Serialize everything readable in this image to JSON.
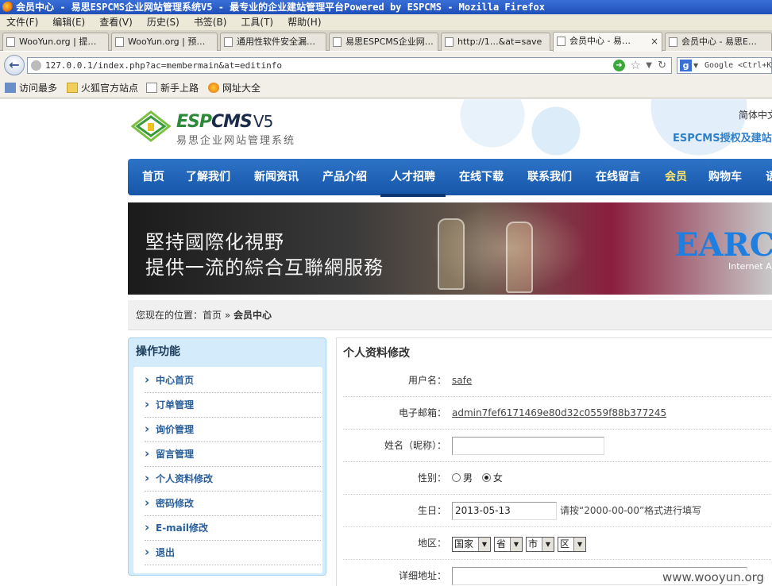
{
  "browser": {
    "title": "会员中心 - 易思ESPCMS企业网站管理系统V5 - 最专业的企业建站管理平台Powered by ESPCMS - Mozilla Firefox",
    "menu": [
      "文件(F)",
      "编辑(E)",
      "查看(V)",
      "历史(S)",
      "书签(B)",
      "工具(T)",
      "帮助(H)"
    ],
    "tabs": [
      {
        "label": "WooYun.org | 提…"
      },
      {
        "label": "WooYun.org | 预…"
      },
      {
        "label": "通用性软件安全漏…"
      },
      {
        "label": "易思ESPCMS企业网…"
      },
      {
        "label": "http://1…&at=save"
      },
      {
        "label": "会员中心 - 易…",
        "close": "×"
      },
      {
        "label": "会员中心 - 易思E…"
      }
    ],
    "url": "127.0.0.1/index.php?ac=membermain&at=editinfo",
    "search_placeholder": "Google <Ctrl+K>",
    "bookmarks": [
      "访问最多",
      "火狐官方站点",
      "新手上路",
      "网址大全"
    ]
  },
  "site": {
    "logo_esp": "ESP",
    "logo_cms": "CMS",
    "logo_version": "V5",
    "logo_sub": "易思企业网站管理系统",
    "lang": "简体中文",
    "auth_link": "ESPCMS授权及建站咨询",
    "nav": [
      "首页",
      "了解我们",
      "新闻资讯",
      "产品介绍",
      "人才招聘",
      "在线下载",
      "联系我们",
      "在线留言",
      "会员",
      "购物车",
      "语"
    ],
    "banner": {
      "line1": "堅持國際化視野",
      "line2": "提供一流的綜合互聯網服務",
      "brand": "EARC",
      "brand_sub": "Internet Ap"
    },
    "breadcrumb": {
      "prefix": "您现在的位置：",
      "home": "首页",
      "sep": "»",
      "current": "会员中心"
    }
  },
  "sidebar": {
    "title": "操作功能",
    "items": [
      "中心首页",
      "订单管理",
      "询价管理",
      "留言管理",
      "个人资料修改",
      "密码修改",
      "E-mail修改",
      "退出"
    ]
  },
  "form": {
    "title": "个人资料修改",
    "username_label": "用户名：",
    "username": "safe",
    "email_label": "电子邮箱：",
    "email": "admin7fef6171469e80d32c0559f88b377245",
    "name_label": "姓名（昵称）：",
    "name_value": "",
    "gender_label": "性别：",
    "gender_male": "男",
    "gender_female": "女",
    "birthday_label": "生日：",
    "birthday": "2013-05-13",
    "birthday_hint": "请按“2000-00-00”格式进行填写",
    "region_label": "地区：",
    "region_country": "国家",
    "region_province": "省",
    "region_city": "市",
    "region_district": "区",
    "address_label": "详细地址："
  },
  "watermark": "www.wooyun.org"
}
